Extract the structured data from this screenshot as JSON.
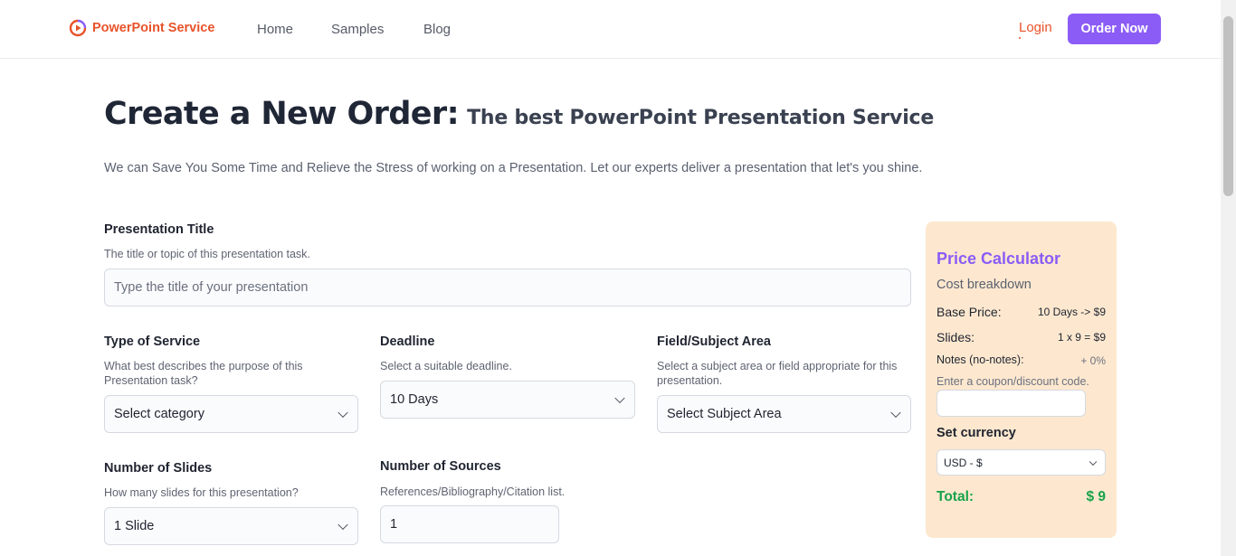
{
  "header": {
    "brand": "PowerPoint Service",
    "logo_icon": "presentation-play-icon",
    "nav": {
      "home": "Home",
      "samples": "Samples",
      "blog": "Blog"
    },
    "login": "Login",
    "order_now": "Order Now",
    "brand_color": "#e8532a",
    "accent_color": "#8b5cf6"
  },
  "page": {
    "title_main": "Create a New Order:",
    "title_sub": "The best PowerPoint Presentation Service",
    "intro": "We can Save You Some Time and Relieve the Stress of working on a Presentation. Let our experts deliver a presentation that let's you shine."
  },
  "form": {
    "presentation_title": {
      "label": "Presentation Title",
      "hint": "The title or topic of this presentation task.",
      "placeholder": "Type the title of your presentation",
      "value": ""
    },
    "service_type": {
      "label": "Type of Service",
      "hint": "What best describes the purpose of this Presentation task?",
      "selected": "Select category"
    },
    "deadline": {
      "label": "Deadline",
      "hint": "Select a suitable deadline.",
      "selected": "10 Days"
    },
    "subject_area": {
      "label": "Field/Subject Area",
      "hint": "Select a subject area or field appropriate for this presentation.",
      "selected": "Select Subject Area"
    },
    "slides": {
      "label": "Number of Slides",
      "hint": "How many slides for this presentation?",
      "selected": "1 Slide"
    },
    "sources": {
      "label": "Number of Sources",
      "hint": "References/Bibliography/Citation list.",
      "value": "1"
    }
  },
  "calculator": {
    "title": "Price Calculator",
    "subtitle": "Cost breakdown",
    "base_price_label": "Base Price:",
    "base_price_value": "10 Days -> $9",
    "slides_label": "Slides:",
    "slides_value": "1 x 9 = $9",
    "notes_label": "Notes (no-notes):",
    "notes_value": "+ 0%",
    "coupon_hint": "Enter a coupon/discount code.",
    "coupon_value": "",
    "currency_label": "Set currency",
    "currency_selected": "USD - $",
    "total_label": "Total:",
    "total_value": "$ 9",
    "background_color": "#fde8cf",
    "total_color": "#16a34a"
  }
}
